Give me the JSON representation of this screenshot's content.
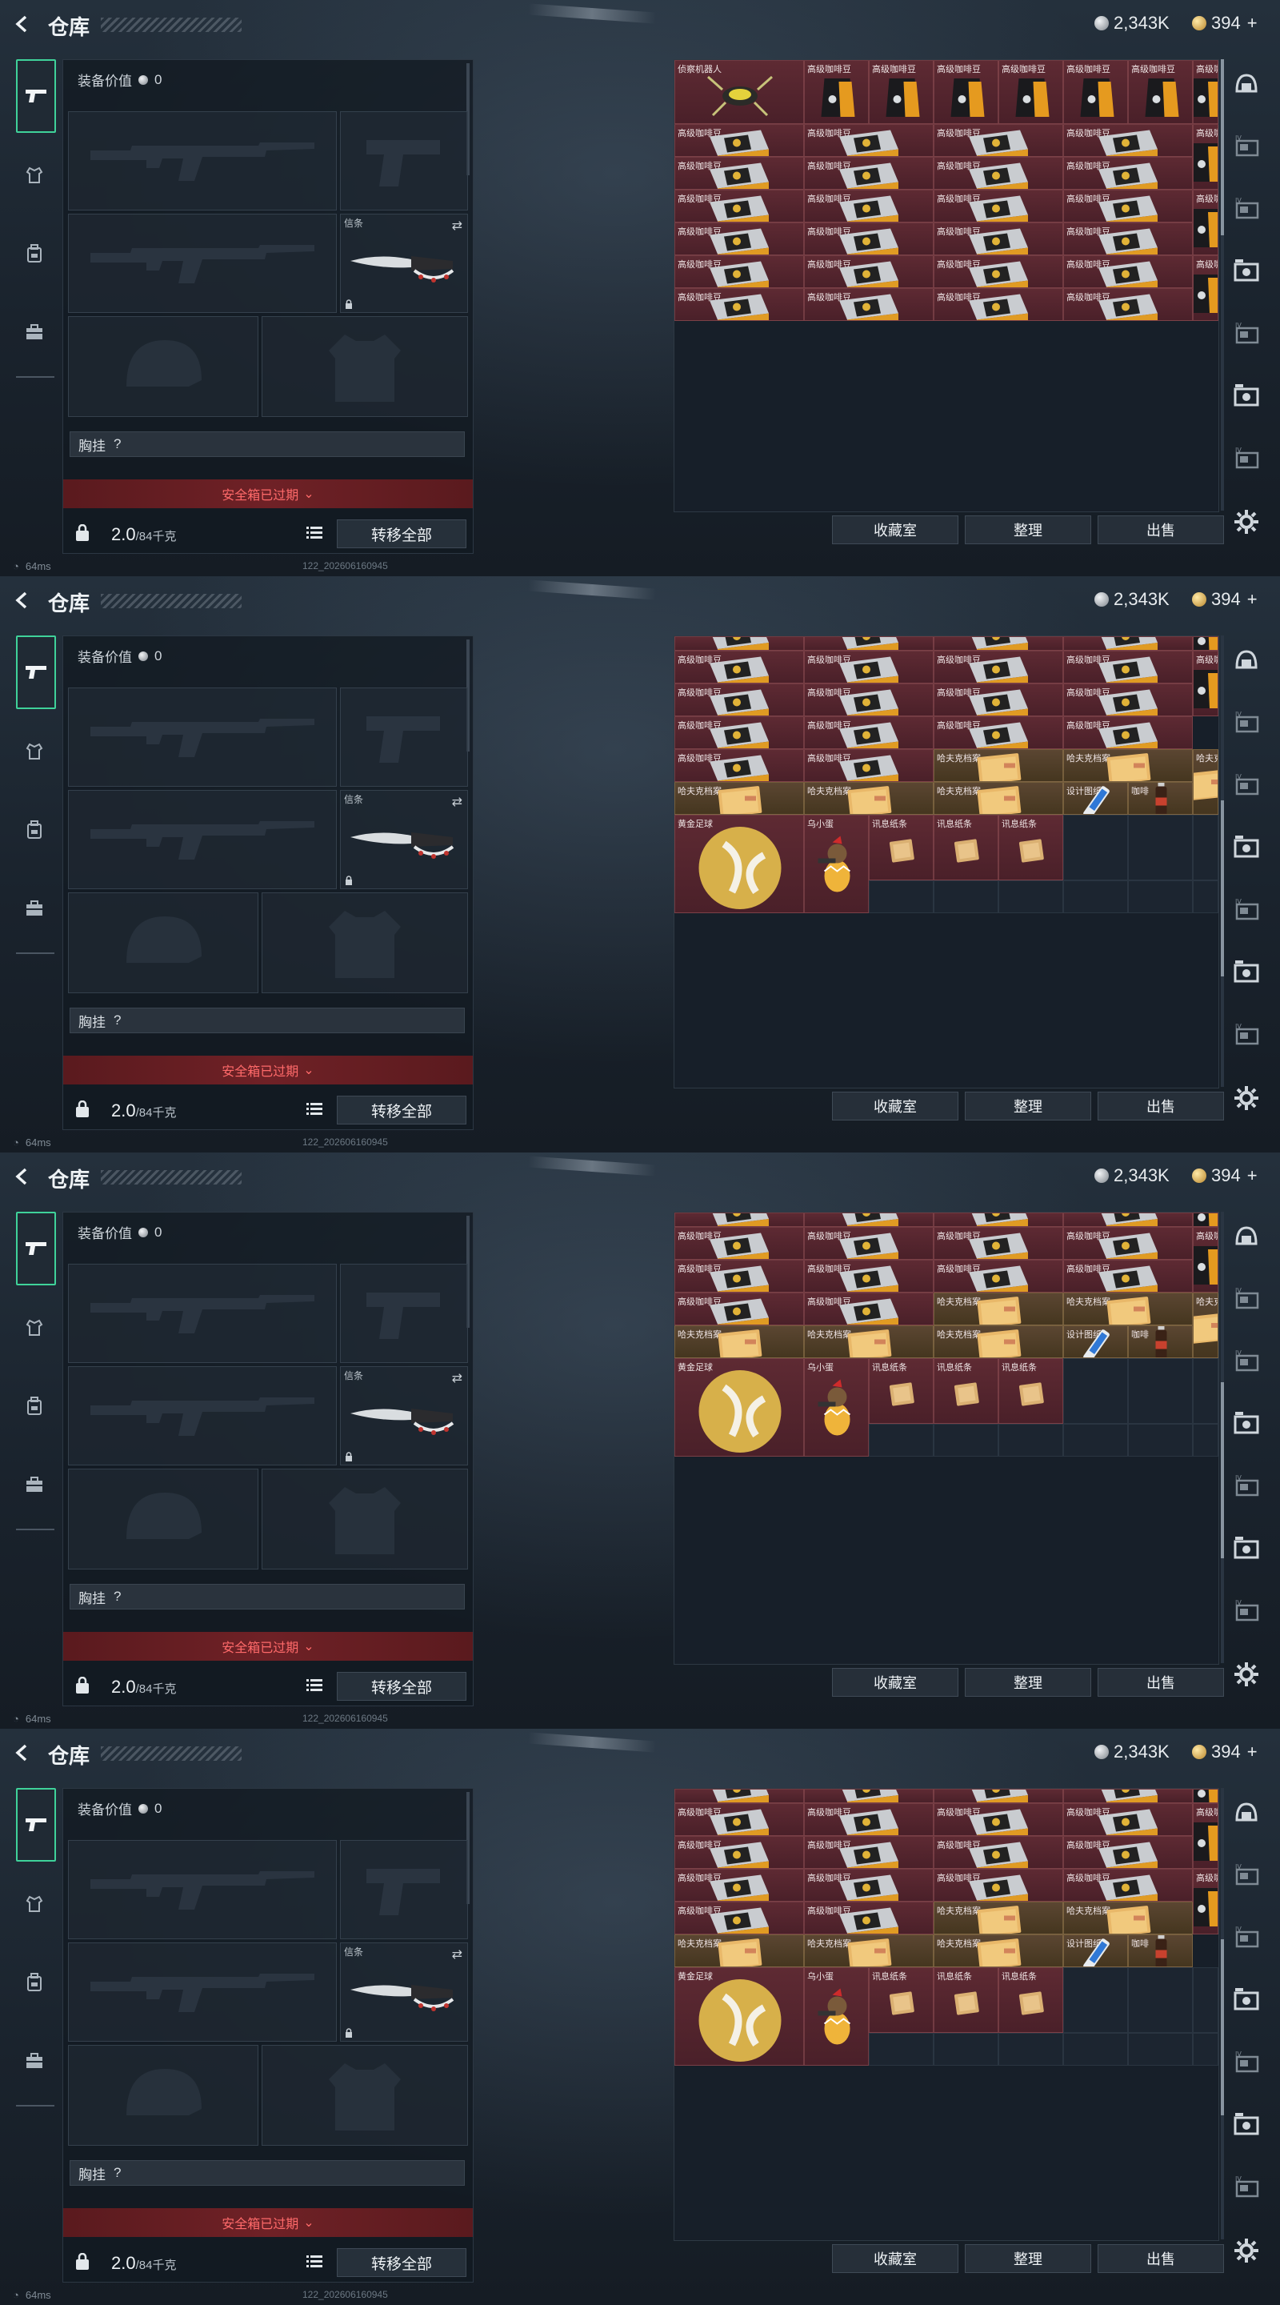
{
  "header": {
    "title": "仓库",
    "currency_silver": "2,343K",
    "currency_gold": "394",
    "plus": "+"
  },
  "sidetabs": [
    "pistol-tab",
    "armor-tab",
    "backpack-tab",
    "briefcase-tab"
  ],
  "equipment": {
    "value_label": "装备价值",
    "value": "0",
    "knife_slot_label": "信条",
    "chest_rig_label": "胸挂",
    "chest_rig_help": "?",
    "safe_box_label": "安全箱已过期",
    "weight": "2.0",
    "weight_max": "/84千克",
    "transfer_all": "转移全部"
  },
  "status": {
    "ping": "64ms",
    "build": "122_202606160945"
  },
  "warehouse": {
    "buttons": {
      "collection": "收藏室",
      "sort": "整理",
      "sell": "出售"
    },
    "item_names": {
      "robot": "侦察机器人",
      "bag": "高级咖啡豆",
      "box": "高级咖啡豆",
      "cont_clip": "高级咖啡豆",
      "file": "哈夫克档案",
      "file_clip": "哈夫克档案",
      "blueprint": "设计图纸",
      "coffee": "咖啡",
      "ball": "黄金足球",
      "egg": "乌小蛋",
      "note": "讯息纸条"
    }
  },
  "screens": [
    {
      "scroll_fraction": 0.0,
      "rows": [
        {
          "h": 80,
          "cells": [
            {
              "t": "robot",
              "span": 2,
              "rowspan": 2
            },
            {
              "t": "bag"
            },
            {
              "t": "bag"
            },
            {
              "t": "bag"
            },
            {
              "t": "bag"
            },
            {
              "t": "bag"
            },
            {
              "t": "bag"
            },
            {
              "t": "bag"
            }
          ]
        },
        {
          "h": 0,
          "cells": []
        },
        {
          "h": 41,
          "cells": [
            {
              "t": "box",
              "span": 2
            },
            {
              "t": "box",
              "span": 2
            },
            {
              "t": "box",
              "span": 2
            },
            {
              "t": "box",
              "span": 2
            },
            {
              "t": "bag",
              "rowspan": 2
            }
          ]
        },
        {
          "h": 41,
          "cells": [
            {
              "t": "box",
              "span": 2
            },
            {
              "t": "box",
              "span": 2
            },
            {
              "t": "box",
              "span": 2
            },
            {
              "t": "box",
              "span": 2
            }
          ]
        },
        {
          "h": 41,
          "cells": [
            {
              "t": "box",
              "span": 2
            },
            {
              "t": "box",
              "span": 2
            },
            {
              "t": "box",
              "span": 2
            },
            {
              "t": "box",
              "span": 2
            },
            {
              "t": "bag",
              "rowspan": 2
            }
          ]
        },
        {
          "h": 41,
          "cells": [
            {
              "t": "box",
              "span": 2
            },
            {
              "t": "box",
              "span": 2
            },
            {
              "t": "box",
              "span": 2
            },
            {
              "t": "box",
              "span": 2
            }
          ]
        },
        {
          "h": 41,
          "cells": [
            {
              "t": "box",
              "span": 2
            },
            {
              "t": "box",
              "span": 2
            },
            {
              "t": "box",
              "span": 2
            },
            {
              "t": "box",
              "span": 2
            },
            {
              "t": "bag",
              "rowspan": 2
            }
          ]
        },
        {
          "h": 41,
          "cells": [
            {
              "t": "box",
              "span": 2
            },
            {
              "t": "box",
              "span": 2
            },
            {
              "t": "box",
              "span": 2
            },
            {
              "t": "box",
              "span": 2
            }
          ]
        }
      ]
    },
    {
      "scroll_fraction": 0.6,
      "rows": [
        {
          "h": 18,
          "cells": [
            {
              "t": "cont_clip",
              "span": 2
            },
            {
              "t": "cont_clip",
              "span": 2
            },
            {
              "t": "cont_clip",
              "span": 2
            },
            {
              "t": "cont_clip",
              "span": 2
            },
            {
              "t": "bag_clip"
            }
          ]
        },
        {
          "h": 41,
          "cells": [
            {
              "t": "box",
              "span": 2
            },
            {
              "t": "box",
              "span": 2
            },
            {
              "t": "box",
              "span": 2
            },
            {
              "t": "box",
              "span": 2
            },
            {
              "t": "bag",
              "rowspan": 2
            }
          ]
        },
        {
          "h": 41,
          "cells": [
            {
              "t": "box",
              "span": 2
            },
            {
              "t": "box",
              "span": 2
            },
            {
              "t": "box",
              "span": 2
            },
            {
              "t": "box",
              "span": 2
            }
          ]
        },
        {
          "h": 41,
          "cells": [
            {
              "t": "box",
              "span": 2
            },
            {
              "t": "box",
              "span": 2
            },
            {
              "t": "box",
              "span": 2
            },
            {
              "t": "box",
              "span": 2
            }
          ]
        },
        {
          "h": 41,
          "cells": [
            {
              "t": "box",
              "span": 2
            },
            {
              "t": "box",
              "span": 2
            },
            {
              "t": "file",
              "span": 2
            },
            {
              "t": "file",
              "span": 2
            },
            {
              "t": "file",
              "rowspan": 2
            }
          ]
        },
        {
          "h": 41,
          "cells": [
            {
              "t": "file",
              "span": 2
            },
            {
              "t": "file",
              "span": 2
            },
            {
              "t": "file",
              "span": 2
            },
            {
              "t": "blueprint"
            },
            {
              "t": "coffee"
            }
          ]
        },
        {
          "h": 82,
          "cells": [
            {
              "t": "ball",
              "span": 2,
              "rowspan": 2
            },
            {
              "t": "egg",
              "rowspan": 2
            },
            {
              "t": "note"
            },
            {
              "t": "note"
            },
            {
              "t": "note"
            },
            {
              "t": "empty"
            },
            {
              "t": "empty"
            },
            {
              "t": "empty"
            }
          ]
        },
        {
          "h": 41,
          "cells": [
            {
              "t": "empty"
            },
            {
              "t": "empty"
            },
            {
              "t": "empty"
            },
            {
              "t": "empty"
            },
            {
              "t": "empty"
            },
            {
              "t": "empty"
            }
          ]
        }
      ]
    },
    {
      "scroll_fraction": 0.62,
      "rows": [
        {
          "h": 18,
          "cells": [
            {
              "t": "cont_clip",
              "span": 2
            },
            {
              "t": "cont_clip",
              "span": 2
            },
            {
              "t": "cont_clip",
              "span": 2
            },
            {
              "t": "cont_clip",
              "span": 2
            },
            {
              "t": "bag_clip"
            }
          ]
        },
        {
          "h": 41,
          "cells": [
            {
              "t": "box",
              "span": 2
            },
            {
              "t": "box",
              "span": 2
            },
            {
              "t": "box",
              "span": 2
            },
            {
              "t": "box",
              "span": 2
            },
            {
              "t": "bag",
              "rowspan": 2
            }
          ]
        },
        {
          "h": 41,
          "cells": [
            {
              "t": "box",
              "span": 2
            },
            {
              "t": "box",
              "span": 2
            },
            {
              "t": "box",
              "span": 2
            },
            {
              "t": "box",
              "span": 2
            }
          ]
        },
        {
          "h": 41,
          "cells": [
            {
              "t": "box",
              "span": 2
            },
            {
              "t": "box",
              "span": 2
            },
            {
              "t": "file",
              "span": 2
            },
            {
              "t": "file",
              "span": 2
            },
            {
              "t": "file",
              "rowspan": 2
            }
          ]
        },
        {
          "h": 41,
          "cells": [
            {
              "t": "file",
              "span": 2
            },
            {
              "t": "file",
              "span": 2
            },
            {
              "t": "file",
              "span": 2
            },
            {
              "t": "blueprint"
            },
            {
              "t": "coffee"
            }
          ]
        },
        {
          "h": 82,
          "cells": [
            {
              "t": "ball",
              "span": 2,
              "rowspan": 2
            },
            {
              "t": "egg",
              "rowspan": 2
            },
            {
              "t": "note"
            },
            {
              "t": "note"
            },
            {
              "t": "note"
            },
            {
              "t": "empty"
            },
            {
              "t": "empty"
            },
            {
              "t": "empty"
            }
          ]
        },
        {
          "h": 41,
          "cells": [
            {
              "t": "empty"
            },
            {
              "t": "empty"
            },
            {
              "t": "empty"
            },
            {
              "t": "empty"
            },
            {
              "t": "empty"
            },
            {
              "t": "empty"
            }
          ]
        }
      ]
    },
    {
      "scroll_fraction": 0.55,
      "rows": [
        {
          "h": 18,
          "cells": [
            {
              "t": "cont_clip",
              "span": 2
            },
            {
              "t": "cont_clip",
              "span": 2
            },
            {
              "t": "cont_clip",
              "span": 2
            },
            {
              "t": "cont_clip",
              "span": 2
            },
            {
              "t": "bag_clip"
            }
          ]
        },
        {
          "h": 41,
          "cells": [
            {
              "t": "box",
              "span": 2
            },
            {
              "t": "box",
              "span": 2
            },
            {
              "t": "box",
              "span": 2
            },
            {
              "t": "box",
              "span": 2
            },
            {
              "t": "bag",
              "rowspan": 2
            }
          ]
        },
        {
          "h": 41,
          "cells": [
            {
              "t": "box",
              "span": 2
            },
            {
              "t": "box",
              "span": 2
            },
            {
              "t": "box",
              "span": 2
            },
            {
              "t": "box",
              "span": 2
            }
          ]
        },
        {
          "h": 41,
          "cells": [
            {
              "t": "box",
              "span": 2
            },
            {
              "t": "box",
              "span": 2
            },
            {
              "t": "box",
              "span": 2
            },
            {
              "t": "box",
              "span": 2
            },
            {
              "t": "bag",
              "rowspan": 2
            }
          ]
        },
        {
          "h": 41,
          "cells": [
            {
              "t": "box",
              "span": 2
            },
            {
              "t": "box",
              "span": 2
            },
            {
              "t": "file",
              "span": 2
            },
            {
              "t": "file",
              "span": 2
            },
            {
              "t": "file",
              "rowspan": 2
            }
          ]
        },
        {
          "h": 41,
          "cells": [
            {
              "t": "file",
              "span": 2
            },
            {
              "t": "file",
              "span": 2
            },
            {
              "t": "file",
              "span": 2
            },
            {
              "t": "blueprint"
            },
            {
              "t": "coffee"
            }
          ]
        },
        {
          "h": 82,
          "cells": [
            {
              "t": "ball",
              "span": 2,
              "rowspan": 2
            },
            {
              "t": "egg",
              "rowspan": 2
            },
            {
              "t": "note"
            },
            {
              "t": "note"
            },
            {
              "t": "note"
            },
            {
              "t": "empty"
            },
            {
              "t": "empty"
            },
            {
              "t": "empty"
            }
          ]
        },
        {
          "h": 41,
          "cells": [
            {
              "t": "empty"
            },
            {
              "t": "empty"
            },
            {
              "t": "empty"
            },
            {
              "t": "empty"
            },
            {
              "t": "empty"
            },
            {
              "t": "empty"
            }
          ]
        }
      ]
    }
  ],
  "rail_icons": [
    "helmet-icon",
    "tv-icon",
    "tv-icon",
    "camera-icon",
    "tv-icon",
    "camera-icon",
    "tv-icon"
  ],
  "colors": {
    "accent_green": "#3fd29a",
    "item_maroon": "#5e2a33",
    "item_brown": "#5b4632",
    "warning_red": "#ff6a6a"
  }
}
